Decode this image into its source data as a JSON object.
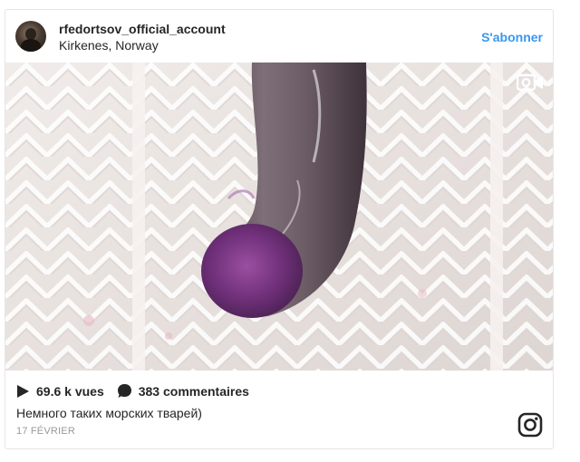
{
  "post": {
    "username": "rfedortsov_official_account",
    "location": "Kirkenes, Norway",
    "follow_label": "S'abonner",
    "views": "69.6 k vues",
    "comments": "383 commentaires",
    "caption": "Немного таких морских тварей)",
    "date": "17 FÉVRIER"
  },
  "icons": {
    "video": "video-camera-icon",
    "play": "play-icon",
    "comment": "comment-bubble-icon",
    "instagram": "instagram-logo-icon"
  },
  "colors": {
    "accent": "#3897f0",
    "text": "#262626",
    "muted": "#999999",
    "border": "#e6e6e6"
  }
}
